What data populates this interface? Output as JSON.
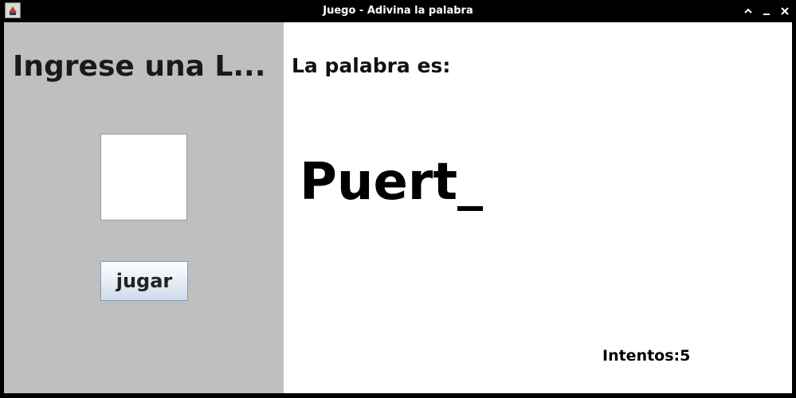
{
  "window": {
    "title": "Juego - Adivina la palabra",
    "icon": "java-cup-icon",
    "controls": [
      "maximize-icon",
      "minimize-icon",
      "close-icon"
    ]
  },
  "left_panel": {
    "prompt": "Ingrese una L...",
    "letter_input_value": "",
    "play_button_label": "jugar"
  },
  "right_panel": {
    "heading": "La palabra es:",
    "word": "Puert_",
    "attempts_label": "Intentos:",
    "attempts_value": "5"
  },
  "colors": {
    "left_panel_bg": "#bfbfbf",
    "right_panel_bg": "#ffffff",
    "titlebar_bg": "#000000"
  }
}
